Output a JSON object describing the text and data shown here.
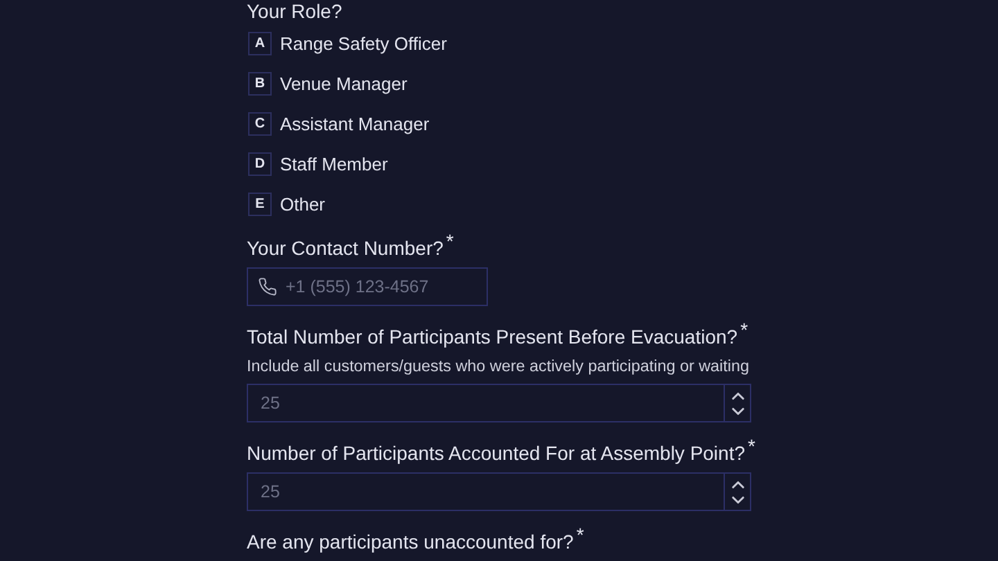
{
  "role_question": {
    "label": "Your Role?",
    "options": [
      {
        "key": "A",
        "label": "Range Safety Officer",
        "selected": false
      },
      {
        "key": "B",
        "label": "Venue Manager",
        "selected": false
      },
      {
        "key": "C",
        "label": "Assistant Manager",
        "selected": false
      },
      {
        "key": "D",
        "label": "Staff Member",
        "selected": false
      },
      {
        "key": "E",
        "label": "Other",
        "selected": false
      }
    ]
  },
  "fields": [
    {
      "kind": "phone",
      "label": "Your Contact Number?",
      "required": "*",
      "placeholder": "+1 (555) 123-4567"
    },
    {
      "kind": "number",
      "label": "Total Number of Participants Present Before Evacuation?",
      "required": "*",
      "hint": "Include all customers/guests who were actively participating or waiting",
      "placeholder": "25"
    },
    {
      "kind": "number",
      "label": "Number of Participants Accounted For at Assembly Point?",
      "required": "*",
      "placeholder": "25"
    },
    {
      "kind": "heading",
      "label": "Are any participants unaccounted for?",
      "required": "*"
    }
  ]
}
